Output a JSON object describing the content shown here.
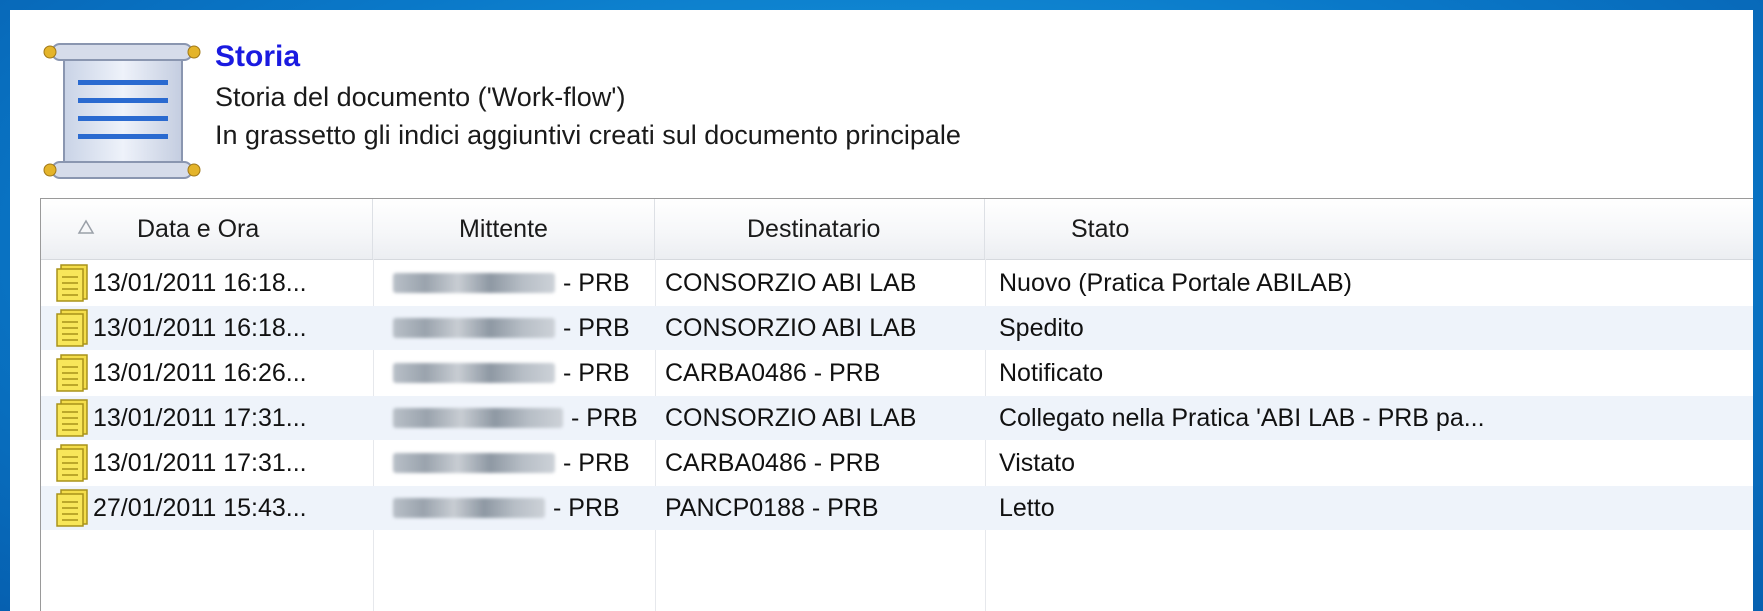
{
  "header": {
    "title": "Storia",
    "description_line1": "Storia del documento ('Work-flow')",
    "description_line2": "In grassetto gli indici aggiuntivi creati sul documento principale"
  },
  "grid": {
    "columns": [
      "Data e Ora",
      "Mittente",
      "Destinatario",
      "Stato"
    ],
    "sort_icon": "sort-ascending-icon",
    "rows": [
      {
        "date": "13/01/2011 16:18...",
        "sender_suffix": "- PRB",
        "recipient": "CONSORZIO ABI LAB",
        "status": "Nuovo (Pratica Portale ABILAB)"
      },
      {
        "date": "13/01/2011 16:18...",
        "sender_suffix": "- PRB",
        "recipient": "CONSORZIO ABI LAB",
        "status": "Spedito"
      },
      {
        "date": "13/01/2011 16:26...",
        "sender_suffix": "- PRB",
        "recipient": "CARBA0486 - PRB",
        "status": "Notificato"
      },
      {
        "date": "13/01/2011 17:31...",
        "sender_suffix": "- PRB",
        "recipient": "CONSORZIO ABI LAB",
        "status": "Collegato nella Pratica 'ABI LAB - PRB pa..."
      },
      {
        "date": "13/01/2011 17:31...",
        "sender_suffix": "- PRB",
        "recipient": "CARBA0486 - PRB",
        "status": "Vistato"
      },
      {
        "date": "27/01/2011 15:43...",
        "sender_suffix": "- PRB",
        "recipient": "PANCP0188 - PRB",
        "status": "Letto"
      }
    ]
  },
  "colors": {
    "title": "#1a1ae0",
    "frame": "#0a78c8",
    "alt_row": "#eef3fa"
  }
}
